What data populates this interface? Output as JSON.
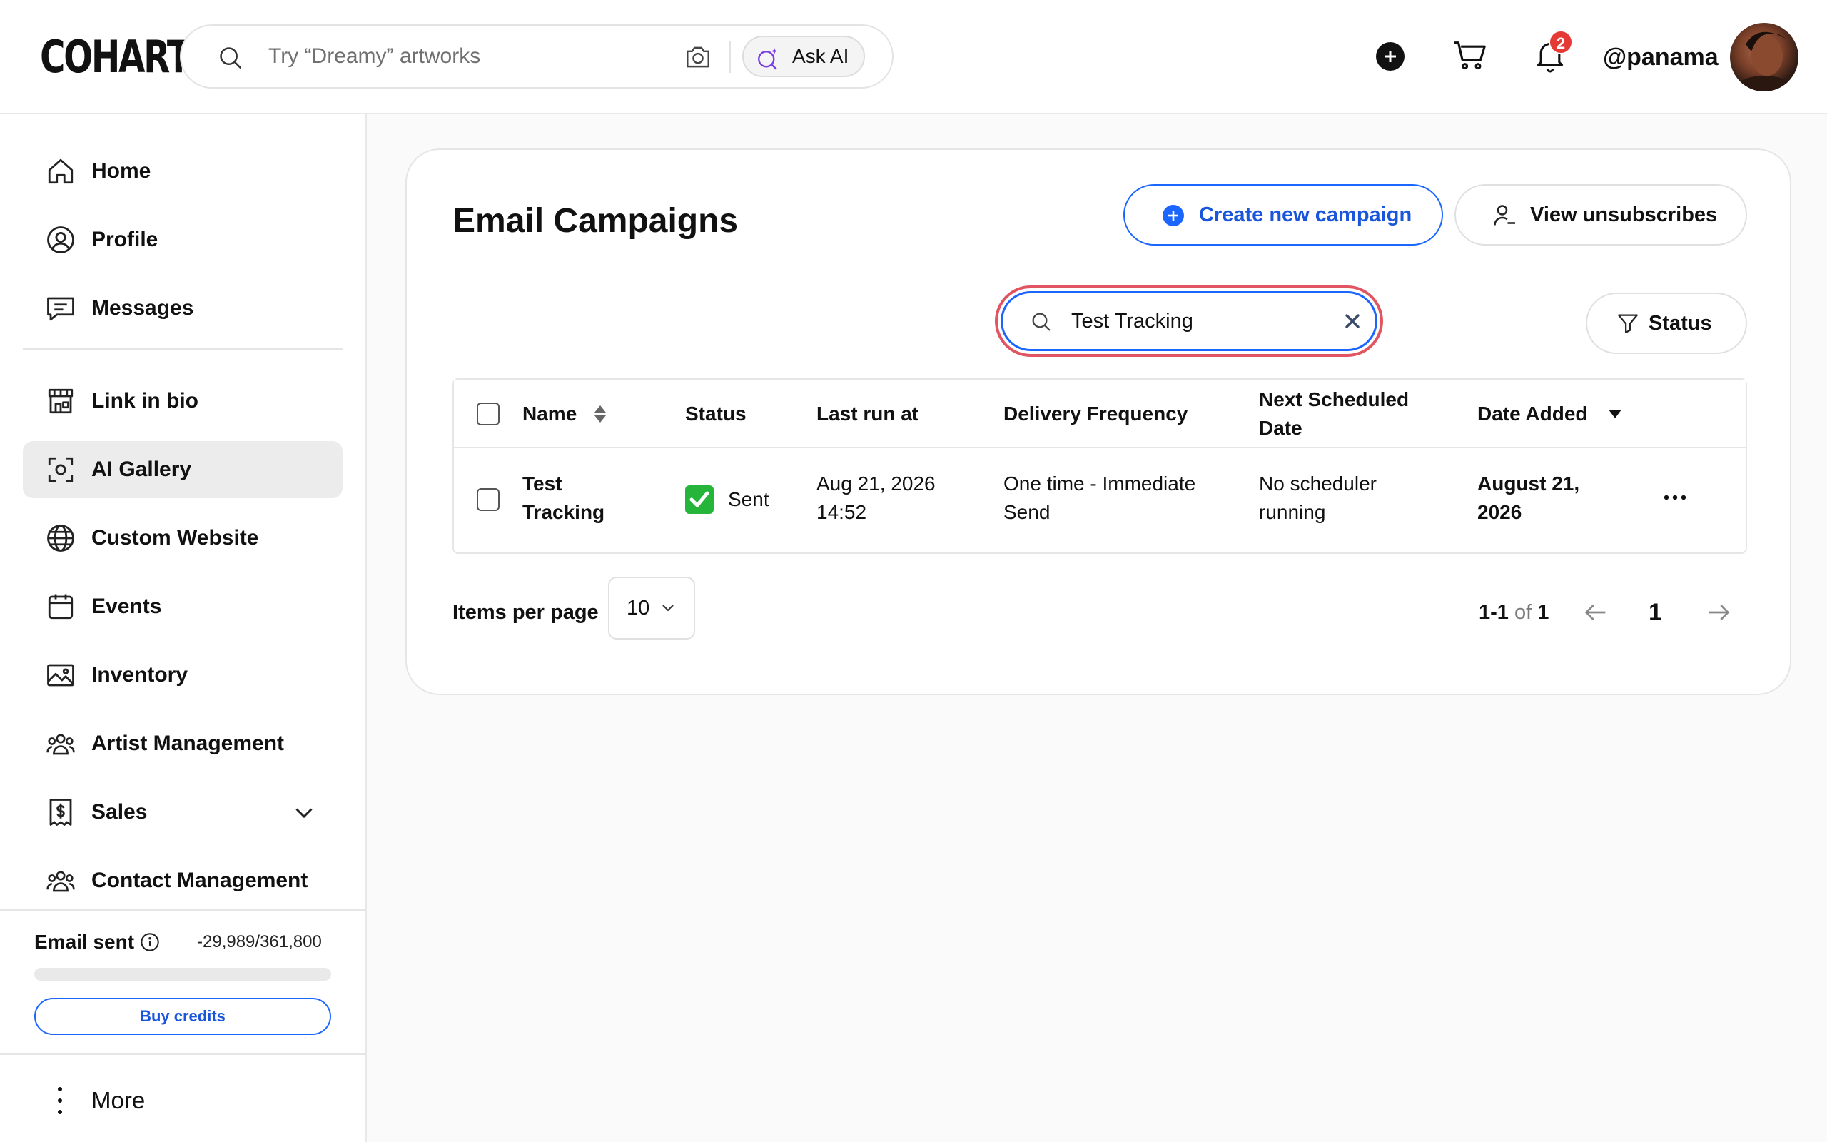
{
  "header": {
    "logo": "COHART",
    "search_placeholder": "Try “Dreamy” artworks",
    "ask_ai_label": "Ask AI",
    "notification_count": "2",
    "username": "@panama"
  },
  "sidebar": {
    "items": [
      {
        "label": "Home",
        "icon": "home-icon"
      },
      {
        "label": "Profile",
        "icon": "profile-icon"
      },
      {
        "label": "Messages",
        "icon": "messages-icon"
      },
      {
        "label": "Link in bio",
        "icon": "storefront-icon"
      },
      {
        "label": "AI Gallery",
        "icon": "scan-icon",
        "active": true
      },
      {
        "label": "Custom Website",
        "icon": "globe-icon"
      },
      {
        "label": "Events",
        "icon": "calendar-icon"
      },
      {
        "label": "Inventory",
        "icon": "image-icon"
      },
      {
        "label": "Artist Management",
        "icon": "people-icon"
      },
      {
        "label": "Sales",
        "icon": "dollar-icon",
        "expandable": true
      },
      {
        "label": "Contact Management",
        "icon": "people-icon"
      }
    ],
    "email_sent_label": "Email sent",
    "email_sent_value": "-29,989/361,800",
    "email_progress": 0,
    "buy_credits_label": "Buy credits",
    "more_label": "More"
  },
  "main": {
    "title": "Email Campaigns",
    "create_button_label": "Create new campaign",
    "unsubscribes_button_label": "View unsubscribes",
    "search_value": "Test Tracking",
    "status_filter_label": "Status",
    "columns": {
      "name": "Name",
      "status": "Status",
      "last_run": "Last run at",
      "frequency": "Delivery Frequency",
      "next_line1": "Next Scheduled",
      "next_line2": "Date",
      "date_added": "Date Added"
    },
    "rows": [
      {
        "name_line1": "Test",
        "name_line2": "Tracking",
        "status": "Sent",
        "last_run_line1": "Aug 21, 2026",
        "last_run_line2": "14:52",
        "frequency_line1": "One time - Immediate",
        "frequency_line2": "Send",
        "next_line1": "No scheduler",
        "next_line2": "running",
        "date_added_line1": "August 21,",
        "date_added_line2": "2026"
      }
    ],
    "items_per_page_label": "Items per page",
    "items_per_page_value": "10",
    "range_start": "1-1",
    "range_of": "of",
    "range_total": "1",
    "current_page": "1"
  },
  "colors": {
    "accent": "#1a66ff",
    "highlight_ring": "#e05561",
    "sent_green": "#25b53a",
    "badge_red": "#e53935"
  }
}
